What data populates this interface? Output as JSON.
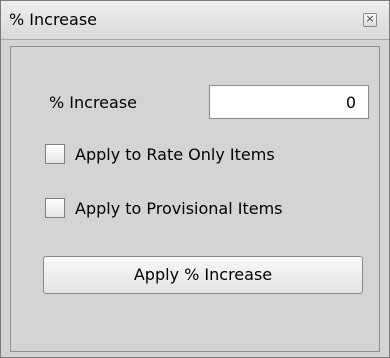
{
  "window": {
    "title": "% Increase",
    "close_icon": "close-icon"
  },
  "form": {
    "increase_label": "% Increase",
    "increase_value": "0",
    "rate_only_label": "Apply to Rate Only Items",
    "rate_only_checked": false,
    "provisional_label": "Apply to Provisional Items",
    "provisional_checked": false,
    "apply_button_label": "Apply % Increase"
  },
  "colors": {
    "window_bg": "#d4d4d4",
    "titlebar_top": "#eeeeee",
    "titlebar_bottom": "#d9d9d9"
  }
}
